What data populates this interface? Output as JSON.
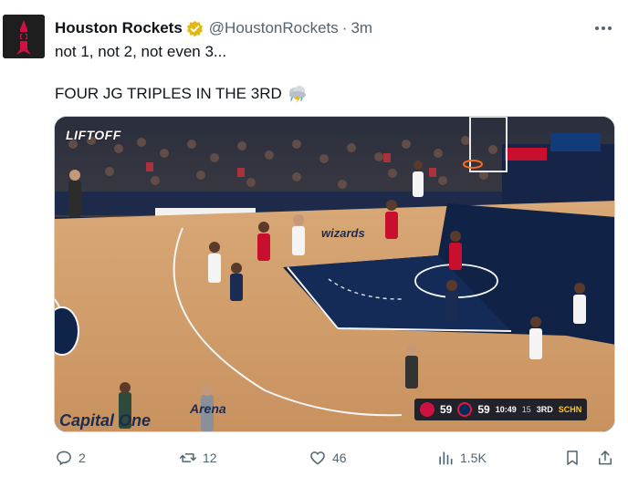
{
  "tweet": {
    "display_name": "Houston Rockets",
    "handle": "@HoustonRockets",
    "separator": "·",
    "time": "3m",
    "text_line1": "not 1, not 2, not even 3...",
    "text_line2": "FOUR JG TRIPLES IN THE 3RD",
    "emoji": "storm-cloud-emoji"
  },
  "media": {
    "watermark": "LIFTOFF",
    "scoreboard": {
      "home_score": "59",
      "away_score": "59",
      "clock": "10:49",
      "period": "3RD",
      "shot_clock": "15",
      "network": "SCHN"
    },
    "court_text": {
      "wizards": "wizards",
      "sponsor": "Capital One",
      "arena": "Arena"
    }
  },
  "actions": {
    "replies": "2",
    "reposts": "12",
    "likes": "46",
    "views": "1.5K"
  },
  "colors": {
    "rockets_red": "#ce1141",
    "wizards_navy": "#002b5c",
    "verified_gold": "#e2b719",
    "muted_text": "#536471"
  }
}
